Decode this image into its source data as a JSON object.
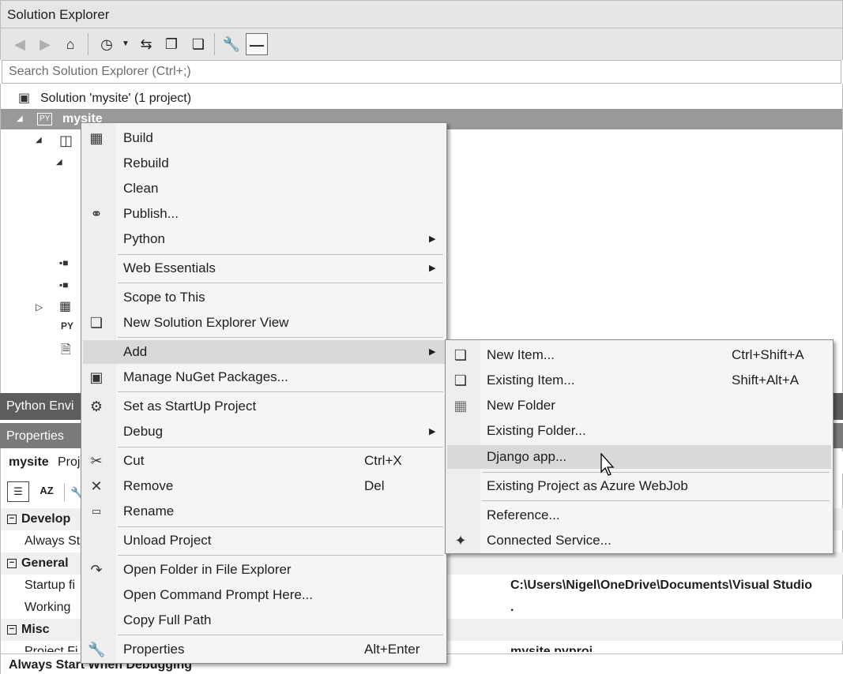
{
  "window": {
    "title": "Solution Explorer"
  },
  "search": {
    "placeholder": "Search Solution Explorer (Ctrl+;)"
  },
  "tree": {
    "solution_label": "Solution 'mysite' (1 project)",
    "project_label": "mysite",
    "project_badge": "PY",
    "py_file_badge": "PY"
  },
  "panels": {
    "python_env_label": "Python Envi",
    "properties_label": "Properties",
    "props_object": "mysite",
    "props_object_type": "Proj"
  },
  "properties": {
    "cat_develop": "Develop",
    "row_always_start": "Always St",
    "cat_general": "General",
    "row_startup_file": "Startup fi",
    "row_startup_value": "C:\\Users\\Nigel\\OneDrive\\Documents\\Visual Studio",
    "row_working": "Working",
    "row_working_value": ".",
    "cat_misc": "Misc",
    "row_project_file": "Project Fi",
    "row_project_value": "mysite.pyproj",
    "description": "Always Start When Debugging"
  },
  "context_menu": {
    "items": [
      {
        "label": "Build",
        "icon": "build-icon"
      },
      {
        "label": "Rebuild"
      },
      {
        "label": "Clean"
      },
      {
        "label": "Publish...",
        "icon": "publish-icon"
      },
      {
        "label": "Python",
        "submenu": true
      },
      {
        "label": "Web Essentials",
        "submenu": true
      },
      {
        "label": "Scope to This"
      },
      {
        "label": "New Solution Explorer View",
        "icon": "new-view-icon"
      },
      {
        "label": "Add",
        "submenu": true,
        "highlighted": true
      },
      {
        "label": "Manage NuGet Packages...",
        "icon": "nuget-icon"
      },
      {
        "label": "Set as StartUp Project",
        "icon": "gear-icon"
      },
      {
        "label": "Debug",
        "submenu": true
      },
      {
        "label": "Cut",
        "shortcut": "Ctrl+X",
        "icon": "scissors-icon"
      },
      {
        "label": "Remove",
        "shortcut": "Del",
        "icon": "remove-x-icon"
      },
      {
        "label": "Rename",
        "icon": "rename-icon"
      },
      {
        "label": "Unload Project"
      },
      {
        "label": "Open Folder in File Explorer",
        "icon": "open-folder-arrow-icon"
      },
      {
        "label": "Open Command Prompt Here..."
      },
      {
        "label": "Copy Full Path"
      },
      {
        "label": "Properties",
        "shortcut": "Alt+Enter",
        "icon": "wrench-icon"
      }
    ]
  },
  "add_submenu": {
    "items": [
      {
        "label": "New Item...",
        "shortcut": "Ctrl+Shift+A",
        "icon": "new-item-icon"
      },
      {
        "label": "Existing Item...",
        "shortcut": "Shift+Alt+A",
        "icon": "existing-item-icon"
      },
      {
        "label": "New Folder",
        "icon": "new-folder-icon"
      },
      {
        "label": "Existing Folder..."
      },
      {
        "label": "Django app...",
        "highlighted": true
      },
      {
        "label": "Existing Project as Azure WebJob"
      },
      {
        "label": "Reference..."
      },
      {
        "label": "Connected Service...",
        "icon": "connected-service-icon"
      }
    ]
  }
}
